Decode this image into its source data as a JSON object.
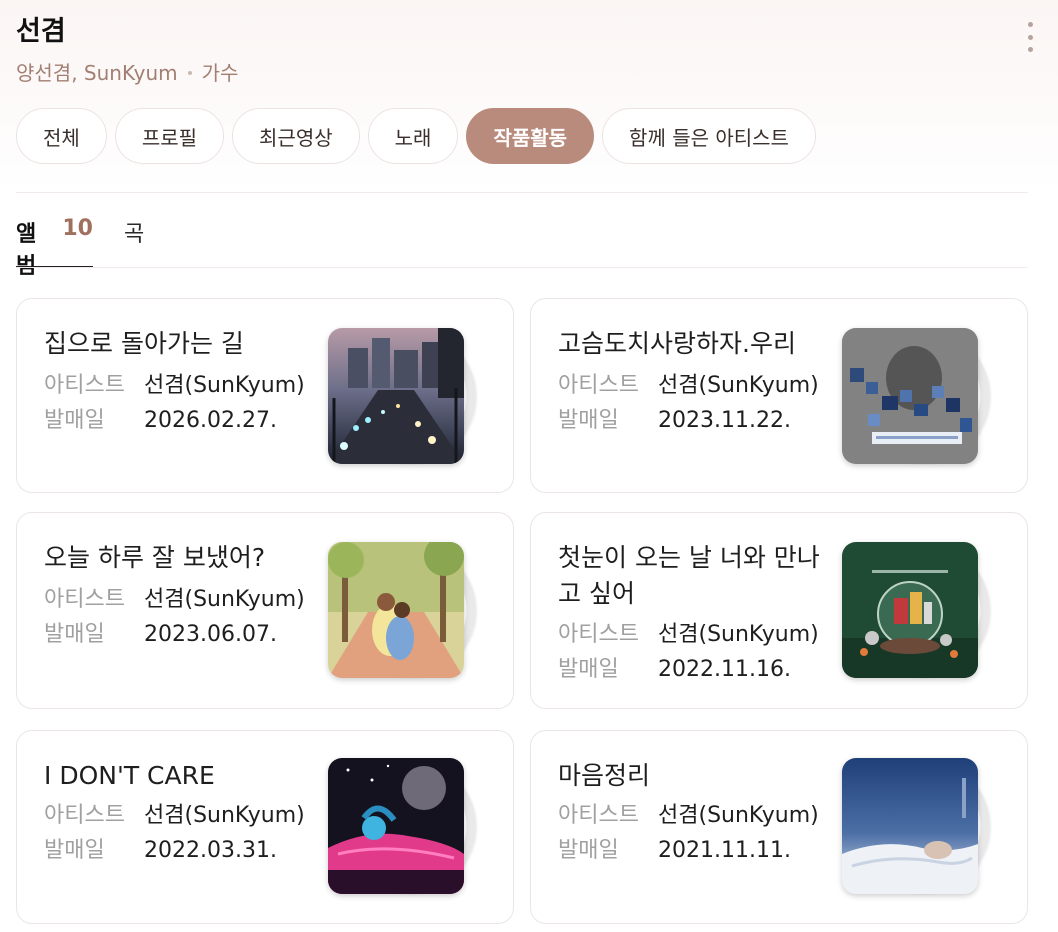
{
  "artist": {
    "name": "선겸",
    "aliases": "양선겸, SunKyum",
    "role": "가수"
  },
  "chips": [
    {
      "label": "전체",
      "active": false
    },
    {
      "label": "프로필",
      "active": false
    },
    {
      "label": "최근영상",
      "active": false
    },
    {
      "label": "노래",
      "active": false
    },
    {
      "label": "작품활동",
      "active": true
    },
    {
      "label": "함께 들은 아티스트",
      "active": false
    }
  ],
  "subtabs": {
    "album_label": "앨범",
    "album_count": "10",
    "song_label": "곡"
  },
  "field_labels": {
    "artist": "아티스트",
    "release_date": "발매일"
  },
  "albums": [
    {
      "title": "집으로 돌아가는 길",
      "artist": "선겸(SunKyum)",
      "release_date": "2026.02.27.",
      "cover_icon": "night-city-road-cover"
    },
    {
      "title": "고슴도치사랑하자.우리",
      "artist": "선겸(SunKyum)",
      "release_date": "2023.11.22.",
      "cover_icon": "pixelated-portrait-cover"
    },
    {
      "title": "오늘 하루 잘 보냈어?",
      "artist": "선겸(SunKyum)",
      "release_date": "2023.06.07.",
      "cover_icon": "illustrated-hug-cover"
    },
    {
      "title": "첫눈이 오는 날 너와 만나고 싶어",
      "artist": "선겸(SunKyum)",
      "release_date": "2022.11.16.",
      "cover_icon": "snow-globe-cover"
    },
    {
      "title": "I DON'T CARE",
      "artist": "선겸(SunKyum)",
      "release_date": "2022.03.31.",
      "cover_icon": "pink-car-cover"
    },
    {
      "title": "마음정리",
      "artist": "선겸(SunKyum)",
      "release_date": "2021.11.11.",
      "cover_icon": "sleeping-figure-cover"
    }
  ],
  "colors": {
    "accent": "#b98b7c",
    "subtitle": "#a27f72",
    "count": "#a0705f",
    "label_gray": "#a0a0a0"
  }
}
